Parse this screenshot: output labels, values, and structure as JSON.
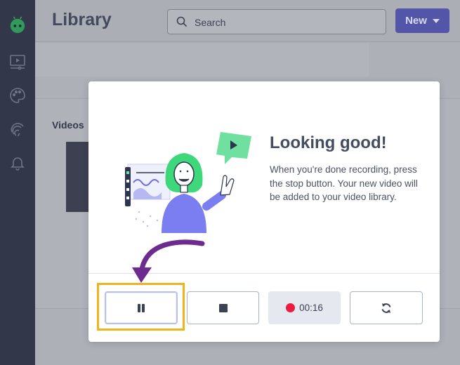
{
  "sidebar": {
    "items": [
      {
        "icon": "bug-logo-icon"
      },
      {
        "icon": "video-player-icon"
      },
      {
        "icon": "palette-icon"
      },
      {
        "icon": "fingerprint-icon"
      },
      {
        "icon": "bell-icon"
      }
    ]
  },
  "header": {
    "title": "Library",
    "search_placeholder": "Search",
    "new_label": "New"
  },
  "main": {
    "section_title": "Videos"
  },
  "modal": {
    "heading": "Looking good!",
    "body": "When you're done recording, press the stop button. Your new video will be added to your video library.",
    "controls": {
      "pause_icon": "pause-icon",
      "stop_icon": "stop-icon",
      "timer": "00:16",
      "restart_icon": "refresh-icon"
    }
  },
  "colors": {
    "accent": "#5356a8",
    "record": "#ea1c3f",
    "highlight": "#efb31e",
    "annotation_arrow": "#6d2b8f"
  }
}
